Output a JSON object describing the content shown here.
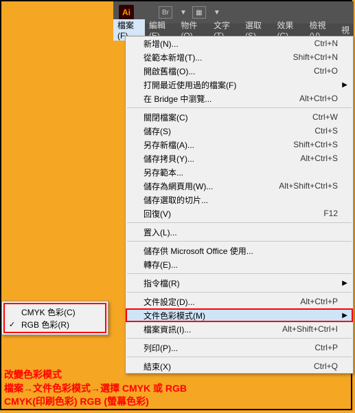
{
  "top": {
    "logo": "Ai",
    "br": "Br",
    "layout": "▦"
  },
  "menubar": [
    "檔案(F)",
    "編輯(E)",
    "物件(O)",
    "文字(T)",
    "選取(S)",
    "效果(C)",
    "檢視(V)",
    "視"
  ],
  "menu": [
    {
      "t": "item",
      "l": "新增(N)...",
      "s": "Ctrl+N"
    },
    {
      "t": "item",
      "l": "從範本新增(T)...",
      "s": "Shift+Ctrl+N"
    },
    {
      "t": "item",
      "l": "開啟舊檔(O)...",
      "s": "Ctrl+O"
    },
    {
      "t": "item",
      "l": "打開最近使用過的檔案(F)",
      "arr": true
    },
    {
      "t": "item",
      "l": "在 Bridge 中瀏覽...",
      "s": "Alt+Ctrl+O"
    },
    {
      "t": "sep"
    },
    {
      "t": "item",
      "l": "關閉檔案(C)",
      "s": "Ctrl+W"
    },
    {
      "t": "item",
      "l": "儲存(S)",
      "s": "Ctrl+S"
    },
    {
      "t": "item",
      "l": "另存新檔(A)...",
      "s": "Shift+Ctrl+S"
    },
    {
      "t": "item",
      "l": "儲存拷貝(Y)...",
      "s": "Alt+Ctrl+S"
    },
    {
      "t": "item",
      "l": "另存範本..."
    },
    {
      "t": "item",
      "l": "儲存為網頁用(W)...",
      "s": "Alt+Shift+Ctrl+S"
    },
    {
      "t": "item",
      "l": "儲存選取的切片..."
    },
    {
      "t": "item",
      "l": "回復(V)",
      "s": "F12"
    },
    {
      "t": "sep"
    },
    {
      "t": "item",
      "l": "置入(L)..."
    },
    {
      "t": "sep"
    },
    {
      "t": "item",
      "l": "儲存供 Microsoft Office 使用..."
    },
    {
      "t": "item",
      "l": "轉存(E)..."
    },
    {
      "t": "sep"
    },
    {
      "t": "item",
      "l": "指令檔(R)",
      "arr": true
    },
    {
      "t": "sep"
    },
    {
      "t": "item",
      "l": "文件設定(D)...",
      "s": "Alt+Ctrl+P"
    },
    {
      "t": "item",
      "l": "文件色彩模式(M)",
      "arr": true,
      "hl": true
    },
    {
      "t": "item",
      "l": "檔案資訊(I)...",
      "s": "Alt+Shift+Ctrl+I"
    },
    {
      "t": "sep"
    },
    {
      "t": "item",
      "l": "列印(P)...",
      "s": "Ctrl+P"
    },
    {
      "t": "sep"
    },
    {
      "t": "item",
      "l": "結束(X)",
      "s": "Ctrl+Q"
    }
  ],
  "submenu": [
    {
      "l": "CMYK 色彩(C)",
      "chk": false
    },
    {
      "l": "RGB 色彩(R)",
      "chk": true
    }
  ],
  "caption": {
    "l1": "改變色彩模式",
    "l2": "檔案→文件色彩模式→選擇 CMYK 或 RGB",
    "l3": "CMYK(印刷色彩)   RGB (螢幕色彩)"
  }
}
